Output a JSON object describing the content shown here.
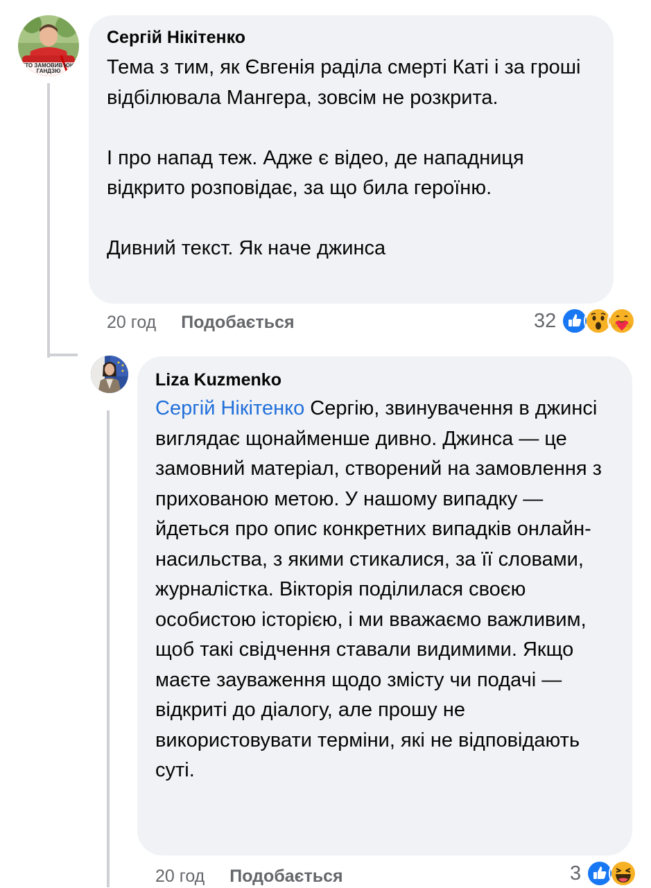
{
  "comments": [
    {
      "author": "Сергій Нікітенко",
      "avatar_caption": "ХТО ЗАМОВИВ ЮЮ ГАНДЗЮ",
      "paragraphs": [
        "Тема з тим, як Євгенія раділа смерті Каті і за гроші відбілювала Мангера, зовсім не розкрита.",
        "І про напад теж. Адже є відео, де нападниця відкрито розповідає, за що била героїню.",
        "Дивний текст. Як наче джинса"
      ],
      "time": "20 год",
      "like_label": "Подобається",
      "reaction_count": "32",
      "reactions": [
        "like-icon",
        "wow-icon",
        "care-icon"
      ]
    },
    {
      "author": "Liza Kuzmenko",
      "mention": "Сергій Нікітенко",
      "text": "Сергію, звинувачення в джинсі виглядає щонайменше дивно. Джинса — це замовний матеріал, створений на замовлення з прихованою метою. У нашому випадку — йдеться про опис конкретних випадків онлайн-насильства, з якими стикалися, за її словами, журналістка. Вікторія поділилася своєю особистою історією, і ми вважаємо важливим, щоб такі свідчення ставали видимими. Якщо маєте зауваження щодо змісту чи подачі — відкриті до діалогу, але прошу не використовувати терміни, які не відповідають суті.",
      "time": "20 год",
      "like_label": "Подобається",
      "reaction_count": "3",
      "reactions": [
        "like-icon",
        "haha-icon"
      ]
    }
  ],
  "colors": {
    "bubble": "#f0f2f5",
    "mention": "#216fdb",
    "meta": "#65676b",
    "like_blue": "#1877f2",
    "emoji_yellow": "#f7b125"
  }
}
